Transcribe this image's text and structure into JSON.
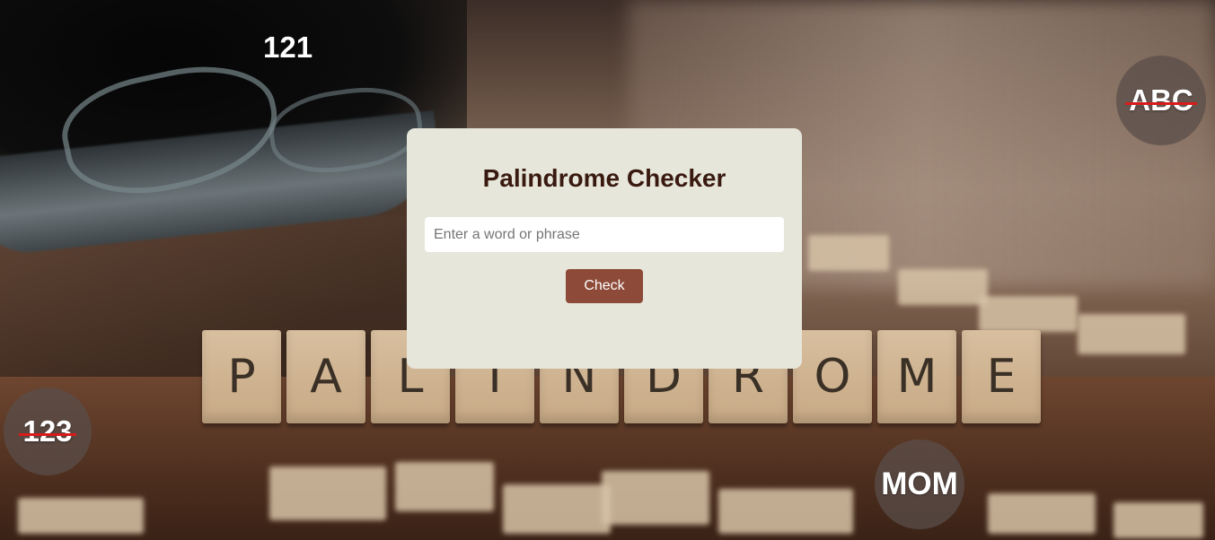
{
  "app": {
    "title": "Palindrome Checker"
  },
  "form": {
    "input_placeholder": "Enter a word or phrase",
    "input_value": "",
    "check_button_label": "Check"
  },
  "decorations": {
    "top_number": "121",
    "abc_badge": "ABC",
    "num_badge": "123",
    "mom_badge": "MOM",
    "tiles": [
      "P",
      "A",
      "L",
      "I",
      "N",
      "D",
      "R",
      "O",
      "M",
      "E"
    ]
  },
  "colors": {
    "card_background": "#e6e6da",
    "title_color": "#3a1a10",
    "button_color": "#8d4a38",
    "strike_color": "#d81b1b"
  }
}
